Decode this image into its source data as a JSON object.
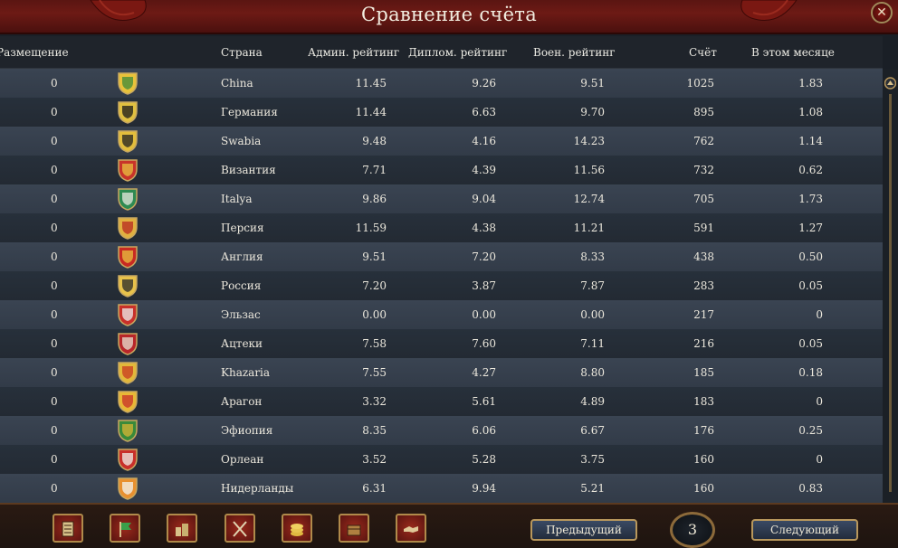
{
  "window": {
    "title": "Сравнение счёта",
    "close_symbol": "✕"
  },
  "columns": {
    "placement": "Размещение",
    "country": "Страна",
    "admin": "Админ. рейтинг",
    "diplo": "Диплом. рейтинг",
    "military": "Воен. рейтинг",
    "score": "Счёт",
    "this_month": "В этом месяце"
  },
  "rows": [
    {
      "placement": "0",
      "country": "China",
      "admin": "11.45",
      "diplo": "9.26",
      "military": "9.51",
      "score": "1025",
      "month": "1.83",
      "shield": [
        "#e8c23a",
        "#3d8a3a"
      ]
    },
    {
      "placement": "0",
      "country": "Германия",
      "admin": "11.44",
      "diplo": "6.63",
      "military": "9.70",
      "score": "895",
      "month": "1.08",
      "shield": [
        "#e0c040",
        "#1a1a1a"
      ]
    },
    {
      "placement": "0",
      "country": "Swabia",
      "admin": "9.48",
      "diplo": "4.16",
      "military": "14.23",
      "score": "762",
      "month": "1.14",
      "shield": [
        "#e3be3c",
        "#222222"
      ]
    },
    {
      "placement": "0",
      "country": "Византия",
      "admin": "7.71",
      "diplo": "4.39",
      "military": "11.56",
      "score": "732",
      "month": "0.62",
      "shield": [
        "#c8342a",
        "#e8c040"
      ]
    },
    {
      "placement": "0",
      "country": "Italya",
      "admin": "9.86",
      "diplo": "9.04",
      "military": "12.74",
      "score": "705",
      "month": "1.73",
      "shield": [
        "#2e8a52",
        "#e8e8e0"
      ]
    },
    {
      "placement": "0",
      "country": "Персия",
      "admin": "11.59",
      "diplo": "4.38",
      "military": "11.21",
      "score": "591",
      "month": "1.27",
      "shield": [
        "#e0b040",
        "#b82a20"
      ]
    },
    {
      "placement": "0",
      "country": "Англия",
      "admin": "9.51",
      "diplo": "7.20",
      "military": "8.33",
      "score": "438",
      "month": "0.50",
      "shield": [
        "#c82a22",
        "#e8c040"
      ]
    },
    {
      "placement": "0",
      "country": "Россия",
      "admin": "7.20",
      "diplo": "3.87",
      "military": "7.87",
      "score": "283",
      "month": "0.05",
      "shield": [
        "#e8c24a",
        "#2a2a2a"
      ]
    },
    {
      "placement": "0",
      "country": "Эльзас",
      "admin": "0.00",
      "diplo": "0.00",
      "military": "0.00",
      "score": "217",
      "month": "0",
      "shield": [
        "#c8302a",
        "#eeeeee"
      ]
    },
    {
      "placement": "0",
      "country": "Ацтеки",
      "admin": "7.58",
      "diplo": "7.60",
      "military": "7.11",
      "score": "216",
      "month": "0.05",
      "shield": [
        "#b8262a",
        "#e8e0d0"
      ]
    },
    {
      "placement": "0",
      "country": "Khazaria",
      "admin": "7.55",
      "diplo": "4.27",
      "military": "8.80",
      "score": "185",
      "month": "0.18",
      "shield": [
        "#e2b83a",
        "#c83a22"
      ]
    },
    {
      "placement": "0",
      "country": "Арагон",
      "admin": "3.32",
      "diplo": "5.61",
      "military": "4.89",
      "score": "183",
      "month": "0",
      "shield": [
        "#e8b836",
        "#c8302a"
      ]
    },
    {
      "placement": "0",
      "country": "Эфиопия",
      "admin": "8.35",
      "diplo": "6.06",
      "military": "6.67",
      "score": "176",
      "month": "0.25",
      "shield": [
        "#3a8a3a",
        "#d8b436"
      ]
    },
    {
      "placement": "0",
      "country": "Орлеан",
      "admin": "3.52",
      "diplo": "5.28",
      "military": "3.75",
      "score": "160",
      "month": "0",
      "shield": [
        "#c8302a",
        "#f0f0ea"
      ]
    },
    {
      "placement": "0",
      "country": "Нидерланды",
      "admin": "6.31",
      "diplo": "9.94",
      "military": "5.21",
      "score": "160",
      "month": "0.83",
      "shield": [
        "#e89030",
        "#f4f4f0"
      ]
    }
  ],
  "footer": {
    "prev_label": "Предыдущий",
    "next_label": "Следующий",
    "page": "3",
    "tools": [
      "ledger-icon",
      "flag-icon",
      "buildings-icon",
      "crossed-swords-icon",
      "coins-icon",
      "trade-goods-icon",
      "handshake-icon"
    ]
  },
  "colors": {
    "title_bar": "#6d1a15",
    "row_odd": "#3a4452",
    "row_even": "#27303b",
    "gold_border": "#b8975c"
  }
}
